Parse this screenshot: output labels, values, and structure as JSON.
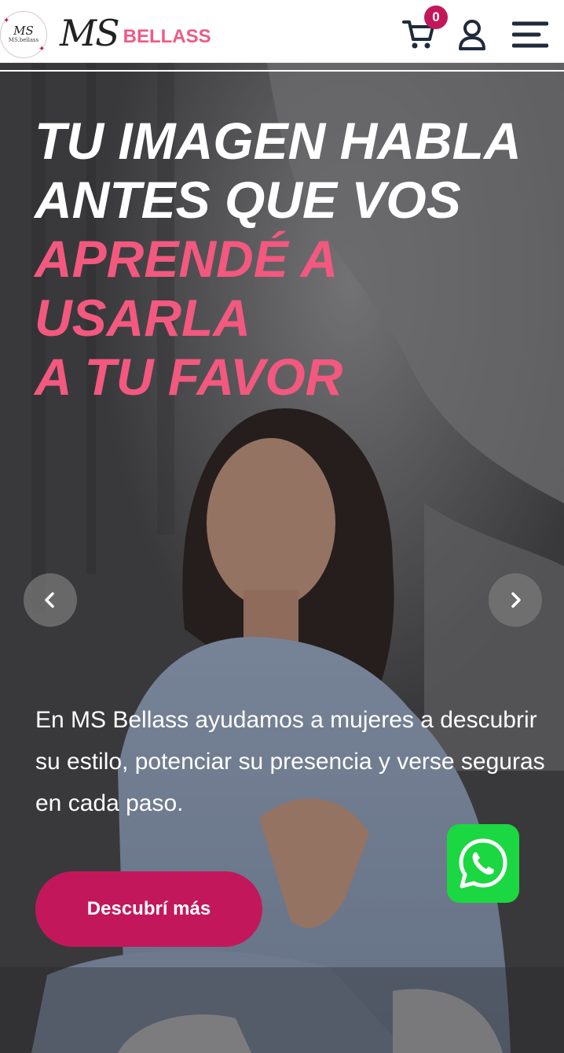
{
  "header": {
    "logo_badge_main": "MS",
    "logo_badge_sub": "MS.bellass",
    "logo_script": "MS",
    "logo_word": "BELLASS",
    "cart_count": "0",
    "icons": [
      "cart-icon",
      "user-icon",
      "menu-icon"
    ]
  },
  "hero": {
    "headline_line1": "TU IMAGEN HABLA",
    "headline_line2": "ANTES QUE VOS",
    "headline_line3": "APRENDÉ A USARLA",
    "headline_line4": "A TU FAVOR",
    "description": "En MS Bellass ayudamos a mujeres a descubrir su estilo, potenciar su presencia y verse seguras en cada paso.",
    "cta_label": "Descubrí más",
    "carousel_icons": [
      "chevron-left-icon",
      "chevron-right-icon"
    ],
    "whatsapp_icon": "whatsapp-icon"
  },
  "colors": {
    "accent_pink": "#f3587f",
    "brand_magenta": "#c2185b",
    "whatsapp_green": "#1bd741",
    "logo_pink": "#ef5a83"
  }
}
